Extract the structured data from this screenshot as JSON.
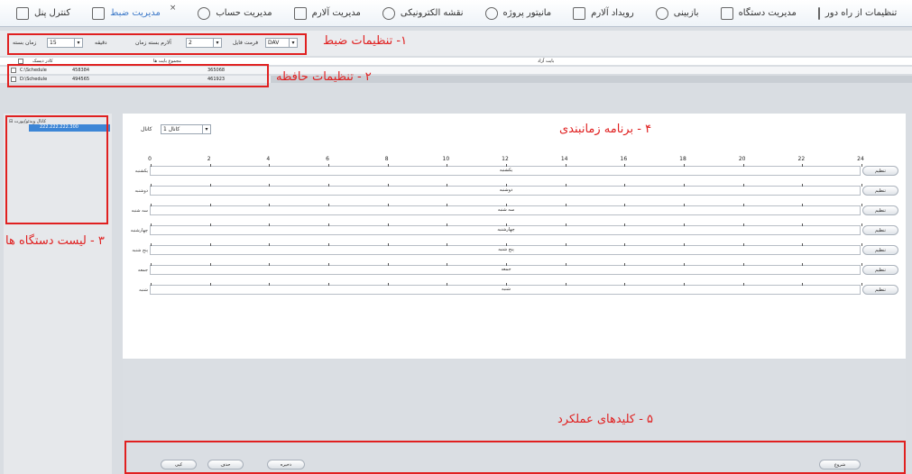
{
  "toolbar": {
    "items": [
      {
        "label": "تنظیمات از راه دور",
        "icon": "remote-settings-icon"
      },
      {
        "label": "مدیریت دستگاه",
        "icon": "device-management-icon"
      },
      {
        "label": "بازبینی",
        "icon": "playback-icon"
      },
      {
        "label": "رویداد آلارم",
        "icon": "alarm-event-icon"
      },
      {
        "label": "مانیتور پروژه",
        "icon": "project-monitor-icon"
      },
      {
        "label": "نقشه الکترونیکی",
        "icon": "emap-icon"
      },
      {
        "label": "مدیریت آلارم",
        "icon": "alarm-bell-icon"
      },
      {
        "label": "مدیریت حساب",
        "icon": "user-account-icon"
      },
      {
        "label": "مدیریت ضبط",
        "icon": "video-record-icon"
      },
      {
        "label": "کنترل پنل",
        "icon": "control-panel-grid-icon"
      }
    ],
    "close_symbol": "×"
  },
  "record_settings": {
    "record_time_label": "زمان بسته",
    "record_time_value": "15",
    "minute_label": "دقیقه",
    "alarm_label": "آلارم بسته زمان",
    "alarm_value": "2",
    "format_label": "فرمت فایل",
    "format_value": "DAV"
  },
  "memory": {
    "headers": {
      "disk": "کادر دیسک",
      "total": "مجموع بایت ها",
      "free": "بایت آزاد"
    },
    "rows": [
      {
        "path": "C:\\Schedule",
        "total": "458384",
        "free": "365068"
      },
      {
        "path": "D:\\Schedule",
        "total": "494565",
        "free": "461923"
      }
    ]
  },
  "device_list": {
    "root": "کانال ویدئو/پورت",
    "device": "222.222.222.300"
  },
  "schedule": {
    "channel_label": "کانال",
    "channel_value": "کانال 1",
    "hours": [
      "0",
      "2",
      "4",
      "6",
      "8",
      "10",
      "12",
      "14",
      "16",
      "18",
      "20",
      "22",
      "24"
    ],
    "days": [
      "یکشنبه",
      "دوشنبه",
      "سه شنبه",
      "چهارشنبه",
      "پنج شنبه",
      "جمعه",
      "شنبه"
    ],
    "set_label": "تنظیم"
  },
  "actions": {
    "start": "شروع",
    "save": "ذخیره",
    "delete": "حذف",
    "copy": "کپی"
  },
  "annotations": {
    "a1": "۱- تنظیمات ضبط",
    "a2": "۲ - تنظیمات حافظه",
    "a3": "۳ - لیست دستگاه ها",
    "a4": "۴ - برنامه زمانبندی",
    "a5": "۵ - کلیدهای عملکرد"
  },
  "colors": {
    "annotation": "#e02020",
    "selected": "#3d86d6"
  }
}
